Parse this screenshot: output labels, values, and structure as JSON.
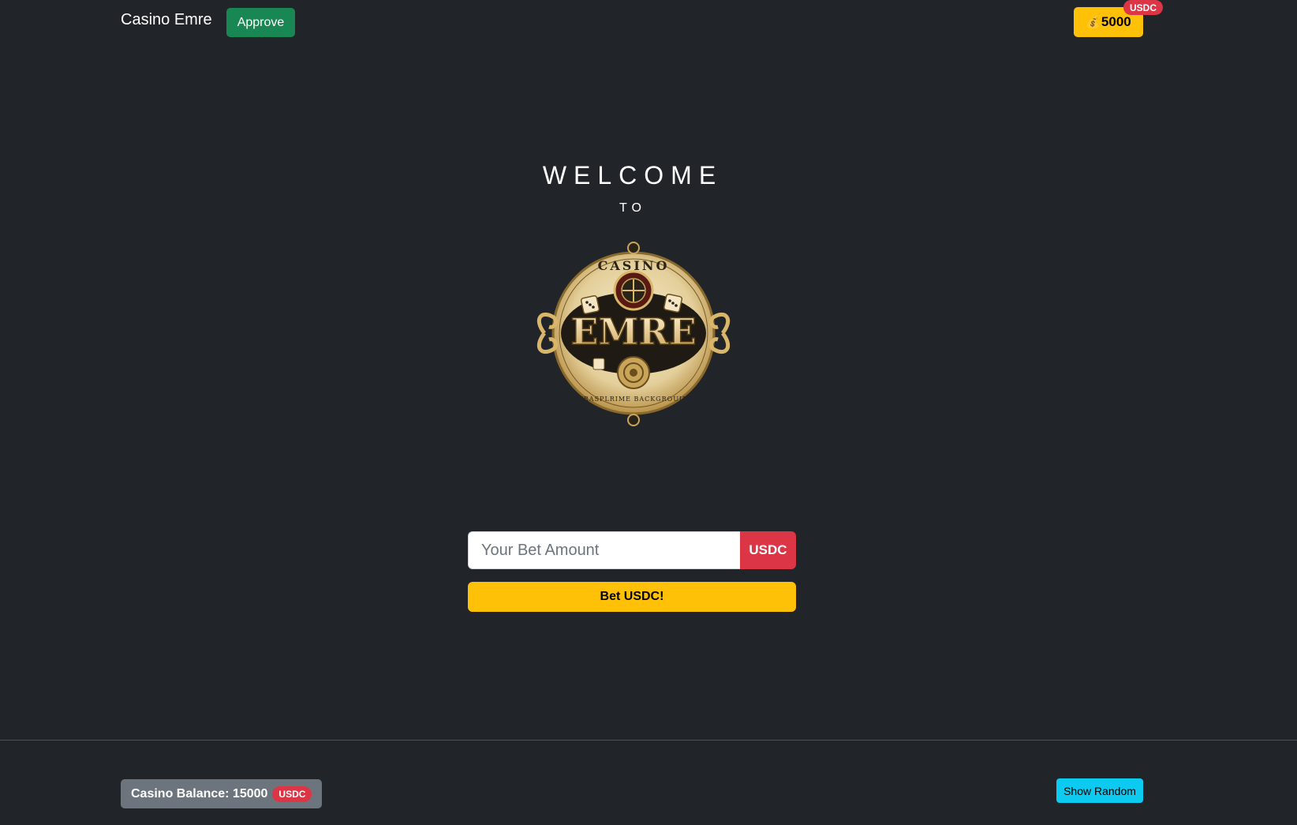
{
  "navbar": {
    "brand": "Casino Emre",
    "approve_label": "Approve",
    "wallet": {
      "coin_icon": "money-bag-icon",
      "balance": "5000",
      "currency_badge": "USDC"
    }
  },
  "hero": {
    "welcome": "WELCOME",
    "to": "TO",
    "logo": {
      "top_text": "CASINO",
      "main_text": "EMRE",
      "bottom_text": "TRASPLRIME BACKGROUID"
    }
  },
  "bet": {
    "placeholder": "Your Bet Amount",
    "currency": "USDC",
    "button_label": "Bet USDC!"
  },
  "footer": {
    "casino_balance_label": "Casino Balance: 15000",
    "casino_balance_currency": "USDC",
    "show_random_label": "Show Random"
  },
  "colors": {
    "background": "#212529",
    "approve": "#198754",
    "accent_yellow": "#ffc107",
    "badge_red": "#dc3545",
    "info_cyan": "#0dcaf0",
    "secondary": "#6c757d"
  }
}
